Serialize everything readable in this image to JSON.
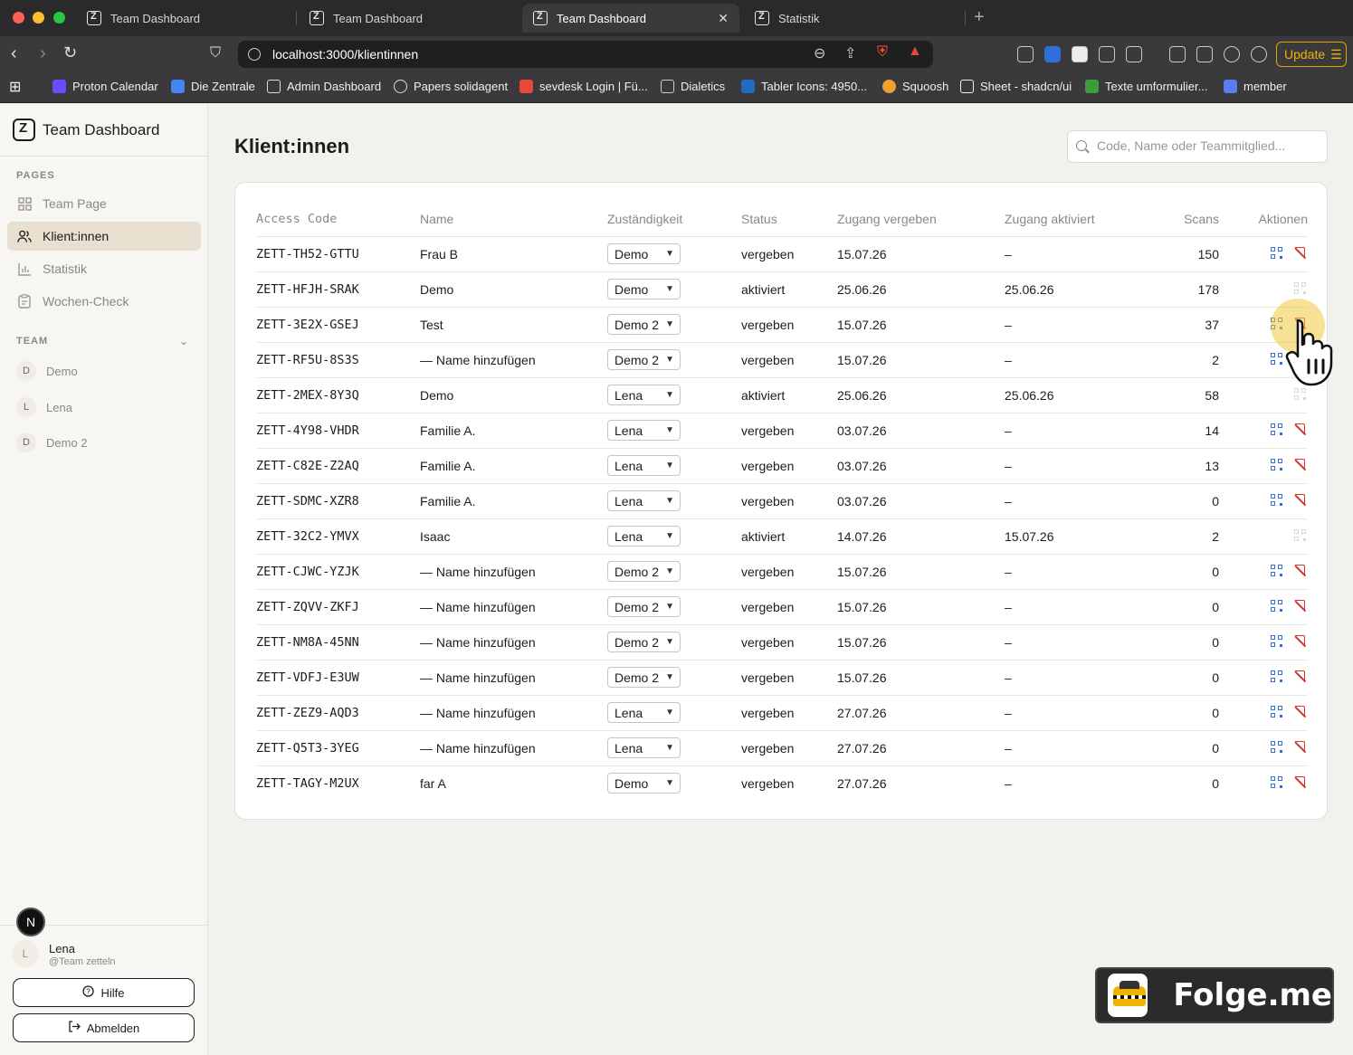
{
  "browser": {
    "tabs": [
      {
        "label": "Team Dashboard"
      },
      {
        "label": "Team Dashboard"
      },
      {
        "label": "Team Dashboard"
      },
      {
        "label": "Statistik"
      }
    ],
    "url": "localhost:3000/klientinnen",
    "update_label": "Update",
    "bookmarks": [
      {
        "label": "Proton Calendar",
        "color": "#6d4aff"
      },
      {
        "label": "Die Zentrale",
        "color": "#4285f4"
      },
      {
        "label": "Admin Dashboard",
        "color": "#dddddd"
      },
      {
        "label": "Papers solidagent",
        "color": "#dddddd"
      },
      {
        "label": "sevdesk Login | Fü...",
        "color": "#e8483b"
      },
      {
        "label": "Dialetics",
        "color": "#cccccc"
      },
      {
        "label": "Tabler Icons: 4950...",
        "color": "#206bc4"
      },
      {
        "label": "Squoosh",
        "color": "#f0a030"
      },
      {
        "label": "Sheet - shadcn/ui",
        "color": "#eeeeee"
      },
      {
        "label": "Texte umformulier...",
        "color": "#3a9e3a"
      },
      {
        "label": "member",
        "color": "#5b7cf0"
      }
    ]
  },
  "sidebar": {
    "brand": "Team Dashboard",
    "pages_label": "PAGES",
    "pages": [
      {
        "label": "Team Page",
        "icon": "layout-grid-icon"
      },
      {
        "label": "Klient:innen",
        "icon": "users-icon"
      },
      {
        "label": "Statistik",
        "icon": "chart-bar-icon"
      },
      {
        "label": "Wochen-Check",
        "icon": "clipboard-icon"
      }
    ],
    "team_label": "TEAM",
    "team": [
      {
        "initial": "D",
        "name": "Demo"
      },
      {
        "initial": "L",
        "name": "Lena"
      },
      {
        "initial": "D",
        "name": "Demo 2"
      }
    ],
    "user": {
      "initial": "L",
      "name": "Lena",
      "handle": "@Team zetteln"
    },
    "help_label": "Hilfe",
    "logout_label": "Abmelden",
    "badge": "N"
  },
  "main": {
    "title": "Klient:innen",
    "search_placeholder": "Code, Name oder Teammitglied...",
    "columns": [
      "Access Code",
      "Name",
      "Zuständigkeit",
      "Status",
      "Zugang vergeben",
      "Zugang aktiviert",
      "Scans",
      "Aktionen"
    ],
    "rows": [
      {
        "code": "ZETT-TH52-GTTU",
        "name": "Frau B",
        "zust": "Demo",
        "status": "vergeben",
        "vergeben": "15.07.26",
        "aktiviert": "–",
        "scans": "150",
        "active": true
      },
      {
        "code": "ZETT-HFJH-SRAK",
        "name": "Demo",
        "zust": "Demo",
        "status": "aktiviert",
        "vergeben": "25.06.26",
        "aktiviert": "25.06.26",
        "scans": "178",
        "active": false
      },
      {
        "code": "ZETT-3E2X-GSEJ",
        "name": "Test",
        "zust": "Demo 2",
        "status": "vergeben",
        "vergeben": "15.07.26",
        "aktiviert": "–",
        "scans": "37",
        "active": true
      },
      {
        "code": "ZETT-RF5U-8S3S",
        "name": "— Name hinzufügen",
        "zust": "Demo 2",
        "status": "vergeben",
        "vergeben": "15.07.26",
        "aktiviert": "–",
        "scans": "2",
        "active": true
      },
      {
        "code": "ZETT-2MEX-8Y3Q",
        "name": "Demo",
        "zust": "Lena",
        "status": "aktiviert",
        "vergeben": "25.06.26",
        "aktiviert": "25.06.26",
        "scans": "58",
        "active": false
      },
      {
        "code": "ZETT-4Y98-VHDR",
        "name": "Familie A.",
        "zust": "Lena",
        "status": "vergeben",
        "vergeben": "03.07.26",
        "aktiviert": "–",
        "scans": "14",
        "active": true
      },
      {
        "code": "ZETT-C82E-Z2AQ",
        "name": "Familie A.",
        "zust": "Lena",
        "status": "vergeben",
        "vergeben": "03.07.26",
        "aktiviert": "–",
        "scans": "13",
        "active": true
      },
      {
        "code": "ZETT-SDMC-XZR8",
        "name": "Familie A.",
        "zust": "Lena",
        "status": "vergeben",
        "vergeben": "03.07.26",
        "aktiviert": "–",
        "scans": "0",
        "active": true
      },
      {
        "code": "ZETT-32C2-YMVX",
        "name": "Isaac",
        "zust": "Lena",
        "status": "aktiviert",
        "vergeben": "14.07.26",
        "aktiviert": "15.07.26",
        "scans": "2",
        "active": false
      },
      {
        "code": "ZETT-CJWC-YZJK",
        "name": "— Name hinzufügen",
        "zust": "Demo 2",
        "status": "vergeben",
        "vergeben": "15.07.26",
        "aktiviert": "–",
        "scans": "0",
        "active": true
      },
      {
        "code": "ZETT-ZQVV-ZKFJ",
        "name": "— Name hinzufügen",
        "zust": "Demo 2",
        "status": "vergeben",
        "vergeben": "15.07.26",
        "aktiviert": "–",
        "scans": "0",
        "active": true
      },
      {
        "code": "ZETT-NM8A-45NN",
        "name": "— Name hinzufügen",
        "zust": "Demo 2",
        "status": "vergeben",
        "vergeben": "15.07.26",
        "aktiviert": "–",
        "scans": "0",
        "active": true
      },
      {
        "code": "ZETT-VDFJ-E3UW",
        "name": "— Name hinzufügen",
        "zust": "Demo 2",
        "status": "vergeben",
        "vergeben": "15.07.26",
        "aktiviert": "–",
        "scans": "0",
        "active": true
      },
      {
        "code": "ZETT-ZEZ9-AQD3",
        "name": "— Name hinzufügen",
        "zust": "Lena",
        "status": "vergeben",
        "vergeben": "27.07.26",
        "aktiviert": "–",
        "scans": "0",
        "active": true
      },
      {
        "code": "ZETT-Q5T3-3YEG",
        "name": "— Name hinzufügen",
        "zust": "Lena",
        "status": "vergeben",
        "vergeben": "27.07.26",
        "aktiviert": "–",
        "scans": "0",
        "active": true
      },
      {
        "code": "ZETT-TAGY-M2UX",
        "name": "far A",
        "zust": "Demo",
        "status": "vergeben",
        "vergeben": "27.07.26",
        "aktiviert": "–",
        "scans": "0",
        "active": true
      }
    ]
  },
  "watermark": "Folge.me"
}
